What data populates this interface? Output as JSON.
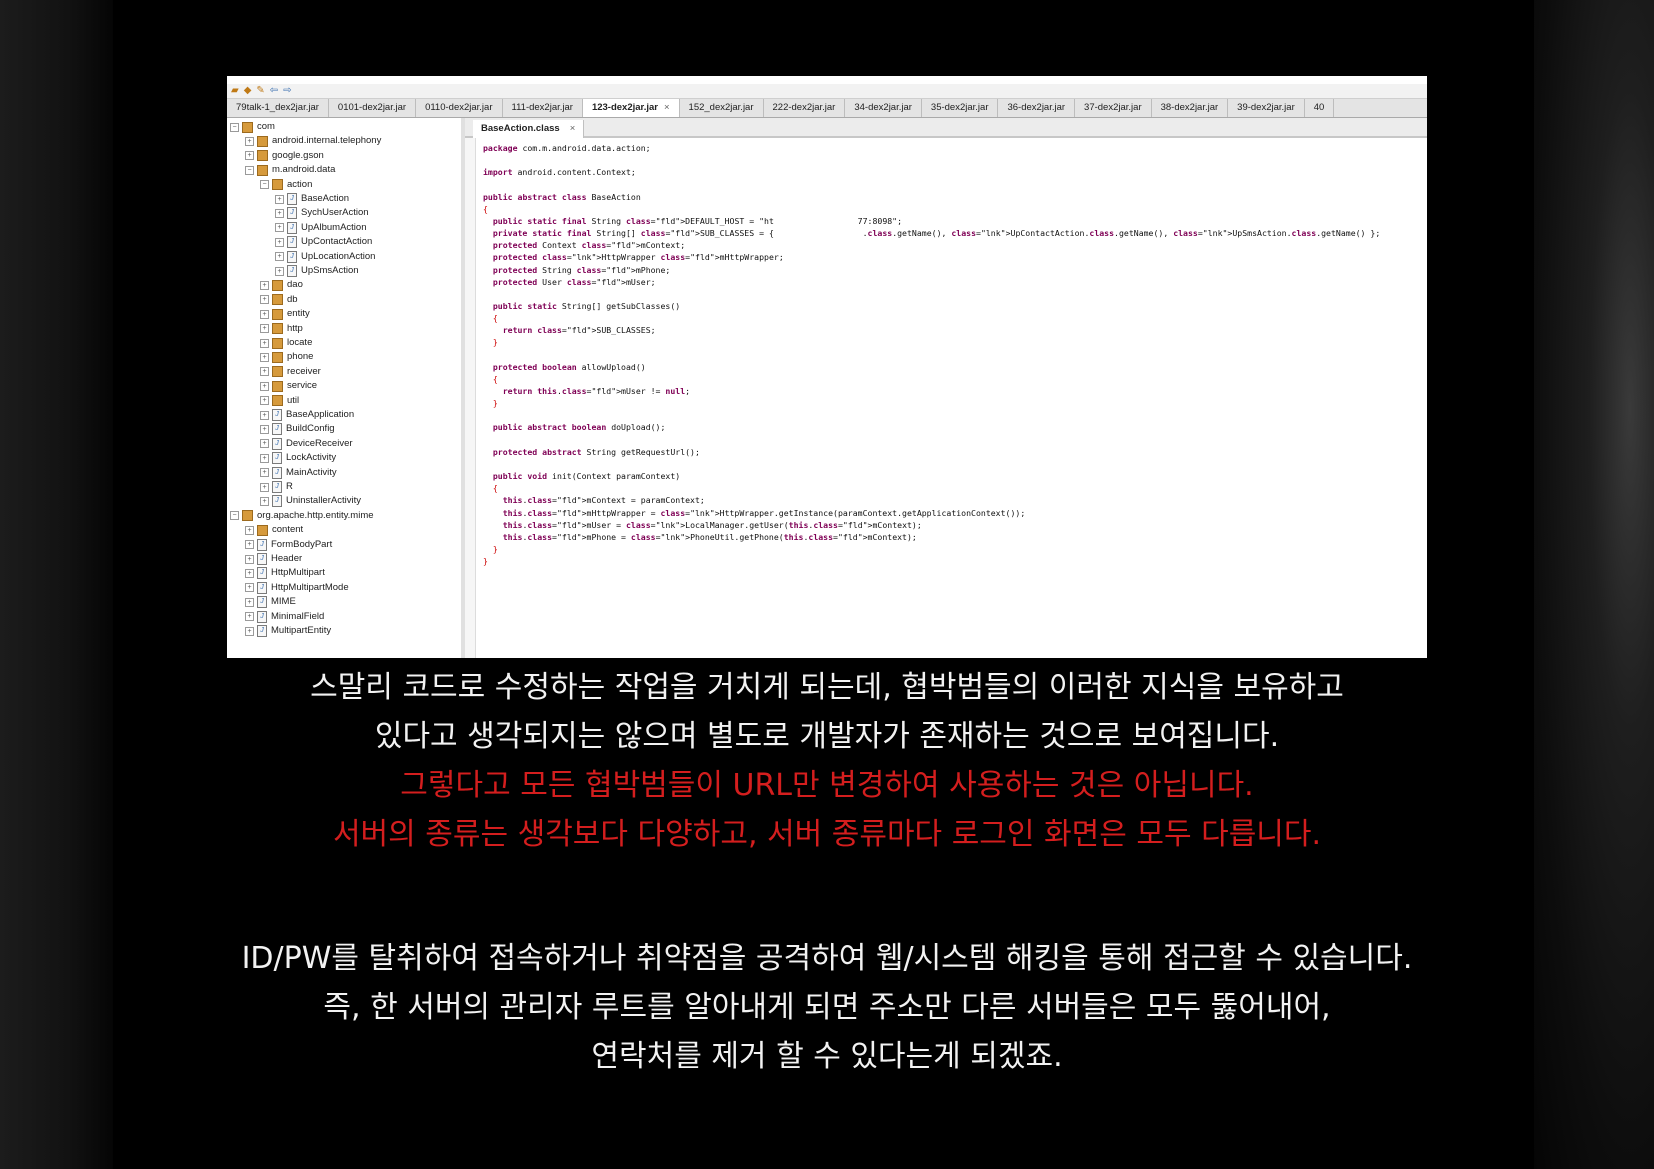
{
  "toolbar": {
    "icons": [
      "open-icon",
      "save-icon",
      "edit-icon",
      "back-arrow-icon",
      "forward-arrow-icon"
    ]
  },
  "tabs": [
    {
      "label": "79talk-1_dex2jar.jar"
    },
    {
      "label": "0101-dex2jar.jar"
    },
    {
      "label": "0110-dex2jar.jar"
    },
    {
      "label": "111-dex2jar.jar"
    },
    {
      "label": "123-dex2jar.jar",
      "active": true
    },
    {
      "label": "152_dex2jar.jar"
    },
    {
      "label": "222-dex2jar.jar"
    },
    {
      "label": "34-dex2jar.jar"
    },
    {
      "label": "35-dex2jar.jar"
    },
    {
      "label": "36-dex2jar.jar"
    },
    {
      "label": "37-dex2jar.jar"
    },
    {
      "label": "38-dex2jar.jar"
    },
    {
      "label": "39-dex2jar.jar"
    },
    {
      "label": "40"
    }
  ],
  "tree": [
    {
      "label": "com",
      "type": "package"
    },
    {
      "label": "android.internal.telephony",
      "type": "package"
    },
    {
      "label": "google.gson",
      "type": "package"
    },
    {
      "label": "m.android.data",
      "type": "package"
    },
    {
      "label": "action",
      "type": "package"
    },
    {
      "label": "BaseAction",
      "type": "class"
    },
    {
      "label": "SychUserAction",
      "type": "class"
    },
    {
      "label": "UpAlbumAction",
      "type": "class"
    },
    {
      "label": "UpContactAction",
      "type": "class"
    },
    {
      "label": "UpLocationAction",
      "type": "class"
    },
    {
      "label": "UpSmsAction",
      "type": "class"
    },
    {
      "label": "dao",
      "type": "package"
    },
    {
      "label": "db",
      "type": "package"
    },
    {
      "label": "entity",
      "type": "package"
    },
    {
      "label": "http",
      "type": "package"
    },
    {
      "label": "locate",
      "type": "package"
    },
    {
      "label": "phone",
      "type": "package"
    },
    {
      "label": "receiver",
      "type": "package"
    },
    {
      "label": "service",
      "type": "package"
    },
    {
      "label": "util",
      "type": "package"
    },
    {
      "label": "BaseApplication",
      "type": "class"
    },
    {
      "label": "BuildConfig",
      "type": "class"
    },
    {
      "label": "DeviceReceiver",
      "type": "class"
    },
    {
      "label": "LockActivity",
      "type": "class"
    },
    {
      "label": "MainActivity",
      "type": "class"
    },
    {
      "label": "R",
      "type": "class"
    },
    {
      "label": "UninstallerActivity",
      "type": "class"
    },
    {
      "label": "org.apache.http.entity.mime",
      "type": "package"
    },
    {
      "label": "content",
      "type": "package"
    },
    {
      "label": "FormBodyPart",
      "type": "class"
    },
    {
      "label": "Header",
      "type": "class"
    },
    {
      "label": "HttpMultipart",
      "type": "class"
    },
    {
      "label": "HttpMultipartMode",
      "type": "class"
    },
    {
      "label": "MIME",
      "type": "class"
    },
    {
      "label": "MinimalField",
      "type": "class"
    },
    {
      "label": "MultipartEntity",
      "type": "class"
    }
  ],
  "editor": {
    "tab_label": "BaseAction.class",
    "code_lines": [
      "package com.m.android.data.action;",
      "",
      "import android.content.Context;",
      "",
      "public abstract class BaseAction",
      "{",
      "  public static final String DEFAULT_HOST = \"ht                 77:8098\";",
      "  private static final String[] SUB_CLASSES = {                  .class.getName(), UpContactAction.class.getName(), UpSmsAction.class.getName() };",
      "  protected Context mContext;",
      "  protected HttpWrapper mHttpWrapper;",
      "  protected String mPhone;",
      "  protected User mUser;",
      "",
      "  public static String[] getSubClasses()",
      "  {",
      "    return SUB_CLASSES;",
      "  }",
      "",
      "  protected boolean allowUpload()",
      "  {",
      "    return this.mUser != null;",
      "  }",
      "",
      "  public abstract boolean doUpload();",
      "",
      "  protected abstract String getRequestUrl();",
      "",
      "  public void init(Context paramContext)",
      "  {",
      "    this.mContext = paramContext;",
      "    this.mHttpWrapper = HttpWrapper.getInstance(paramContext.getApplicationContext());",
      "    this.mUser = LocalManager.getUser(this.mContext);",
      "    this.mPhone = PhoneUtil.getPhone(this.mContext);",
      "  }",
      "}"
    ]
  },
  "caption": {
    "line1": "스말리 코드로 수정하는 작업을 거치게 되는데, 협박범들의 이러한 지식을 보유하고",
    "line2": "있다고 생각되지는 않으며 별도로 개발자가 존재하는 것으로 보여집니다.",
    "line3": "그렇다고 모든 협박범들이 URL만 변경하여 사용하는 것은 아닙니다.",
    "line4": "서버의 종류는 생각보다 다양하고, 서버 종류마다 로그인 화면은 모두 다릅니다.",
    "line5": "ID/PW를 탈취하여 접속하거나 취약점을 공격하여 웹/시스템 해킹을 통해 접근할 수 있습니다.",
    "line6": "즉, 한 서버의 관리자 루트를 알아내게 되면 주소만 다른 서버들은 모두 뚫어내어,",
    "line7": "연락처를 제거 할 수 있다는게 되겠죠.",
    "highlight_color": "#d41e1e"
  }
}
